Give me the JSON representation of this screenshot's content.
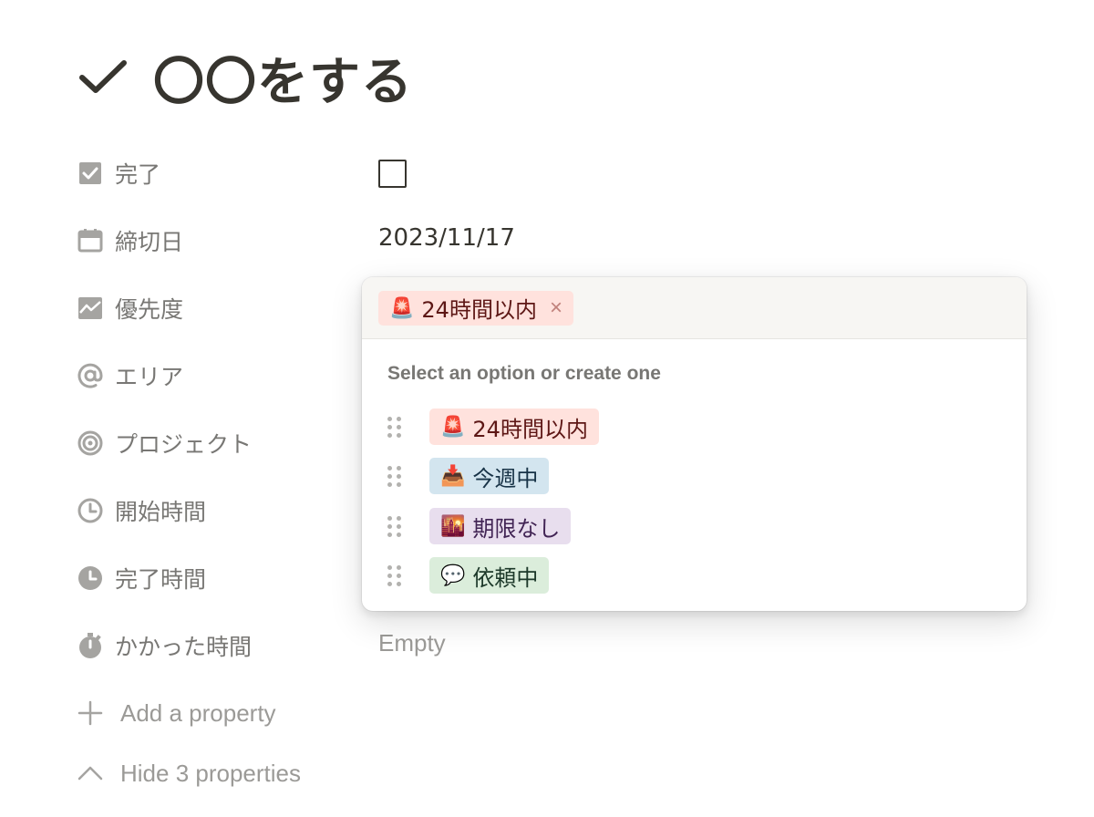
{
  "page": {
    "title": "〇〇をする"
  },
  "properties": [
    {
      "label": "完了",
      "icon": "checkbox-icon"
    },
    {
      "label": "締切日",
      "icon": "calendar-icon"
    },
    {
      "label": "優先度",
      "icon": "chart-icon"
    },
    {
      "label": "エリア",
      "icon": "at-icon"
    },
    {
      "label": "プロジェクト",
      "icon": "target-icon"
    },
    {
      "label": "開始時間",
      "icon": "clock-icon"
    },
    {
      "label": "完了時間",
      "icon": "clock-filled-icon"
    },
    {
      "label": "かかった時間",
      "icon": "stopwatch-icon"
    }
  ],
  "values": {
    "deadline": "2023/11/17",
    "elapsed_time": "Empty"
  },
  "footer": {
    "add_property": "Add a property",
    "hide_properties": "Hide 3 properties"
  },
  "popup": {
    "selected": {
      "emoji": "🚨",
      "label": "24時間以内",
      "remove": "×"
    },
    "hint": "Select an option or create one",
    "options": [
      {
        "emoji": "🚨",
        "label": "24時間以内",
        "bg": "#ffe2dd",
        "fg": "#5d1715"
      },
      {
        "emoji": "📥",
        "label": "今週中",
        "bg": "#d3e5ef",
        "fg": "#183347"
      },
      {
        "emoji": "🌇",
        "label": "期限なし",
        "bg": "#e8deee",
        "fg": "#412454"
      },
      {
        "emoji": "💬",
        "label": "依頼中",
        "bg": "#dbeddb",
        "fg": "#1c3829"
      }
    ]
  },
  "colors": {
    "text": "#37352f",
    "muted": "#787774",
    "faint": "#9b9a97",
    "icon": "#a5a4a1"
  }
}
